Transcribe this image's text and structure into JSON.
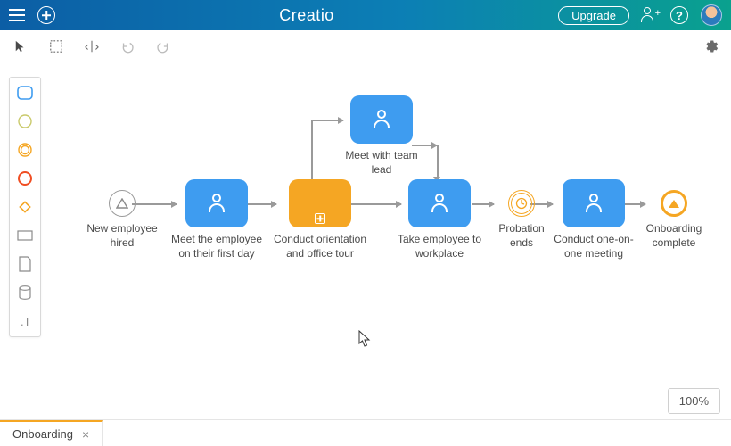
{
  "app": {
    "logo": "Creatio"
  },
  "header": {
    "upgrade_label": "Upgrade"
  },
  "zoom": {
    "level": "100%"
  },
  "tabs": [
    {
      "label": "Onboarding"
    }
  ],
  "palette": {
    "items": [
      "rounded-square-blue",
      "circle-light",
      "circle-double-orange",
      "circle-orange",
      "diamond-orange",
      "rect-gray",
      "page-gray",
      "db-gray",
      "text-tool"
    ]
  },
  "process": {
    "nodes": {
      "start": {
        "label": "New employee hired"
      },
      "task1": {
        "label": "Meet the employee on their first day"
      },
      "task2": {
        "label": "Conduct orientation and office tour"
      },
      "task2b": {
        "label": "Meet with team lead"
      },
      "task3": {
        "label": "Take employee to workplace"
      },
      "timer": {
        "label": "Probation ends"
      },
      "task4": {
        "label": "Conduct one-on-one meeting"
      },
      "end": {
        "label": "Onboarding complete"
      }
    }
  },
  "colors": {
    "blue": "#3e9cf0",
    "orange": "#f5a623",
    "header_gradient_from": "#0c5ea5",
    "header_gradient_to": "#0aa18e"
  }
}
